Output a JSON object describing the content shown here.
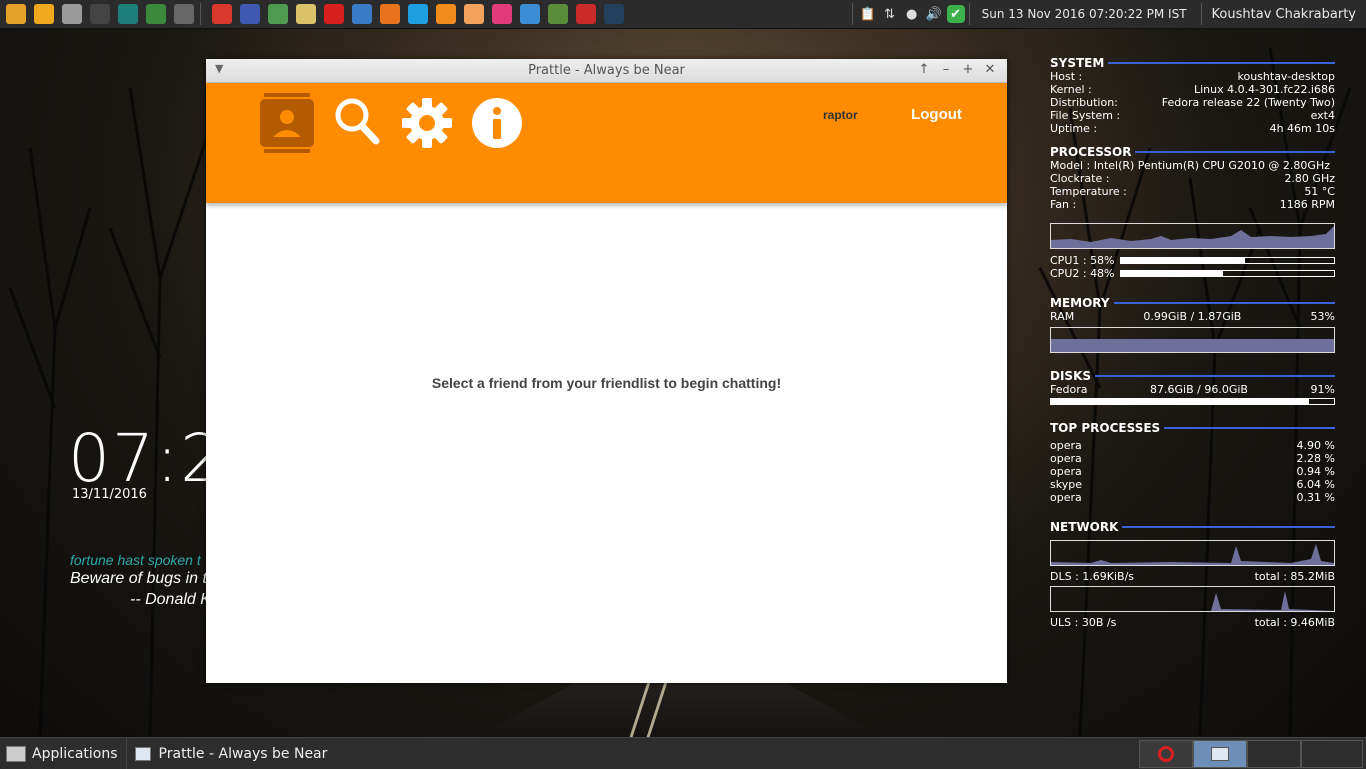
{
  "top_panel": {
    "launchers": [
      {
        "name": "files-icon",
        "color": "#e6a12a"
      },
      {
        "name": "folder-icon",
        "color": "#f0a81c"
      },
      {
        "name": "disk-icon",
        "color": "#9a9a9a"
      },
      {
        "name": "terminal-icon",
        "color": "#444444"
      },
      {
        "name": "magnifier-icon",
        "color": "#1e7f7a"
      },
      {
        "name": "system-monitor-icon",
        "color": "#3b8a3b"
      },
      {
        "name": "screenshot-icon",
        "color": "#666666"
      },
      {
        "name": "office-icon",
        "color": "#d73a2c"
      },
      {
        "name": "intellij-icon",
        "color": "#3d5ab0"
      },
      {
        "name": "android-studio-icon",
        "color": "#4f9a4f"
      },
      {
        "name": "text-editor-icon",
        "color": "#d9c26a"
      },
      {
        "name": "opera-icon",
        "color": "#d6201f"
      },
      {
        "name": "network-icon",
        "color": "#3a7bc8"
      },
      {
        "name": "firefox-icon",
        "color": "#e8731e"
      },
      {
        "name": "skype-icon",
        "color": "#1e9fe0"
      },
      {
        "name": "vlc-icon",
        "color": "#f08a1a"
      },
      {
        "name": "melon-icon",
        "color": "#f2a25c"
      },
      {
        "name": "oo-icon",
        "color": "#e23b7c"
      },
      {
        "name": "remmina-icon",
        "color": "#3b8ed6"
      },
      {
        "name": "minecraft-icon",
        "color": "#5a8c3a"
      },
      {
        "name": "game-icon",
        "color": "#c82a2a"
      },
      {
        "name": "steam-icon",
        "color": "#24405c"
      }
    ],
    "tray_icons": [
      "clipboard-icon",
      "network-updown-icon",
      "chat-bubble-icon",
      "volume-icon",
      "update-check-icon"
    ],
    "datetime": "Sun 13 Nov 2016 07:20:22 PM IST",
    "user": "Koushtav Chakrabarty"
  },
  "desktop": {
    "clock_time": "07:2",
    "clock_date": "13/11/2016",
    "fortune_title": "fortune hast spoken t",
    "fortune_quote": "Beware of bugs in th",
    "fortune_author": "-- Donald K"
  },
  "window": {
    "title": "Prattle - Always be Near",
    "username": "raptor",
    "logout_label": "Logout",
    "empty_message": "Select a friend from your friendlist to begin chatting!",
    "accent": "#ff8c00",
    "icon_dark": "#b45a00"
  },
  "conky": {
    "system": {
      "heading": "SYSTEM",
      "rows": [
        {
          "k": "Host :",
          "v": "koushtav-desktop"
        },
        {
          "k": "Kernel :",
          "v": "Linux 4.0.4-301.fc22.i686"
        },
        {
          "k": "Distribution:",
          "v": "Fedora release 22 (Twenty Two)"
        },
        {
          "k": "File System :",
          "v": "ext4"
        },
        {
          "k": "Uptime :",
          "v": "4h 46m 10s"
        }
      ]
    },
    "processor": {
      "heading": "PROCESSOR",
      "rows": [
        {
          "k": "Model : Intel(R) Pentium(R) CPU G2010 @ 2.80GHz",
          "v": ""
        },
        {
          "k": "Clockrate :",
          "v": "2.80 GHz"
        },
        {
          "k": "Temperature :",
          "v": "51 °C"
        },
        {
          "k": "Fan :",
          "v": "1186 RPM"
        }
      ],
      "cpu1_label": "CPU1 : 58%",
      "cpu1": 0.58,
      "cpu2_label": "CPU2 : 48%",
      "cpu2": 0.48
    },
    "memory": {
      "heading": "MEMORY",
      "ram_label": "RAM",
      "ram_value": "0.99GiB / 1.87GiB",
      "ram_percent": "53%",
      "ram_fraction": 0.53
    },
    "disks": {
      "heading": "DISKS",
      "name": "Fedora",
      "value": "87.6GiB / 96.0GiB",
      "percent": "91%",
      "fraction": 0.91
    },
    "top_processes": {
      "heading": "TOP PROCESSES",
      "rows": [
        {
          "k": "opera",
          "v": "4.90 %"
        },
        {
          "k": "opera",
          "v": "2.28 %"
        },
        {
          "k": "opera",
          "v": "0.94 %"
        },
        {
          "k": "skype",
          "v": "6.04 %"
        },
        {
          "k": "opera",
          "v": "0.31 %"
        }
      ]
    },
    "network": {
      "heading": "NETWORK",
      "dls_label": "DLS : 1.69KiB/s",
      "dls_total": "total : 85.2MiB",
      "uls_label": "ULS : 30B  /s",
      "uls_total": "total : 9.46MiB"
    }
  },
  "taskbar": {
    "applications_label": "Applications",
    "task_label": "Prattle - Always be Near"
  }
}
